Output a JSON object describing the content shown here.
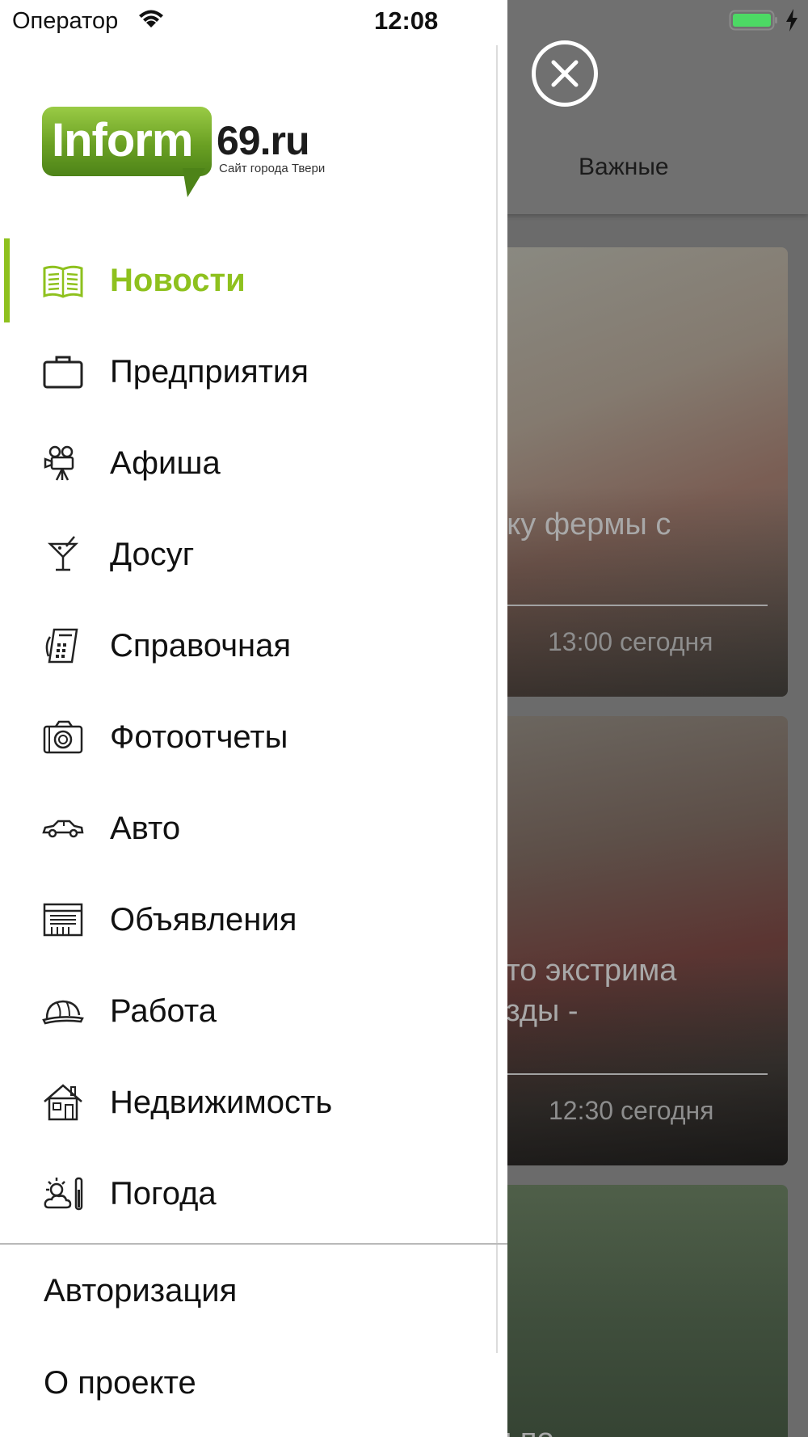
{
  "status_bar": {
    "carrier": "Оператор",
    "time": "12:08",
    "battery_color": "#4cd964"
  },
  "background": {
    "tab_label": "Важные",
    "cards": [
      {
        "title": "ику фермы с",
        "time": "13:00 сегодня"
      },
      {
        "title": "ото экстрима\nезды -",
        "time": "12:30 сегодня"
      },
      {
        "title": "ы по",
        "time": ""
      }
    ]
  },
  "close_icon": "close-circle-icon",
  "logo": {
    "word": "Inform",
    "domain": "69.ru",
    "tagline": "Сайт города Твери",
    "green": "#6aa023"
  },
  "menu": {
    "accent_color": "#8ec11e",
    "active_index": 0,
    "items": [
      {
        "label": "Новости",
        "icon": "newspaper-icon"
      },
      {
        "label": "Предприятия",
        "icon": "briefcase-icon"
      },
      {
        "label": "Афиша",
        "icon": "movie-camera-icon"
      },
      {
        "label": "Досуг",
        "icon": "cocktail-icon"
      },
      {
        "label": "Справочная",
        "icon": "phone-directory-icon"
      },
      {
        "label": "Фотоотчеты",
        "icon": "camera-icon"
      },
      {
        "label": "Авто",
        "icon": "car-icon"
      },
      {
        "label": "Объявления",
        "icon": "classifieds-icon"
      },
      {
        "label": "Работа",
        "icon": "hard-hat-icon"
      },
      {
        "label": "Недвижимость",
        "icon": "house-icon"
      },
      {
        "label": "Погода",
        "icon": "weather-icon"
      }
    ],
    "bottom_items": [
      {
        "label": "Авторизация"
      },
      {
        "label": "О проекте"
      }
    ]
  }
}
